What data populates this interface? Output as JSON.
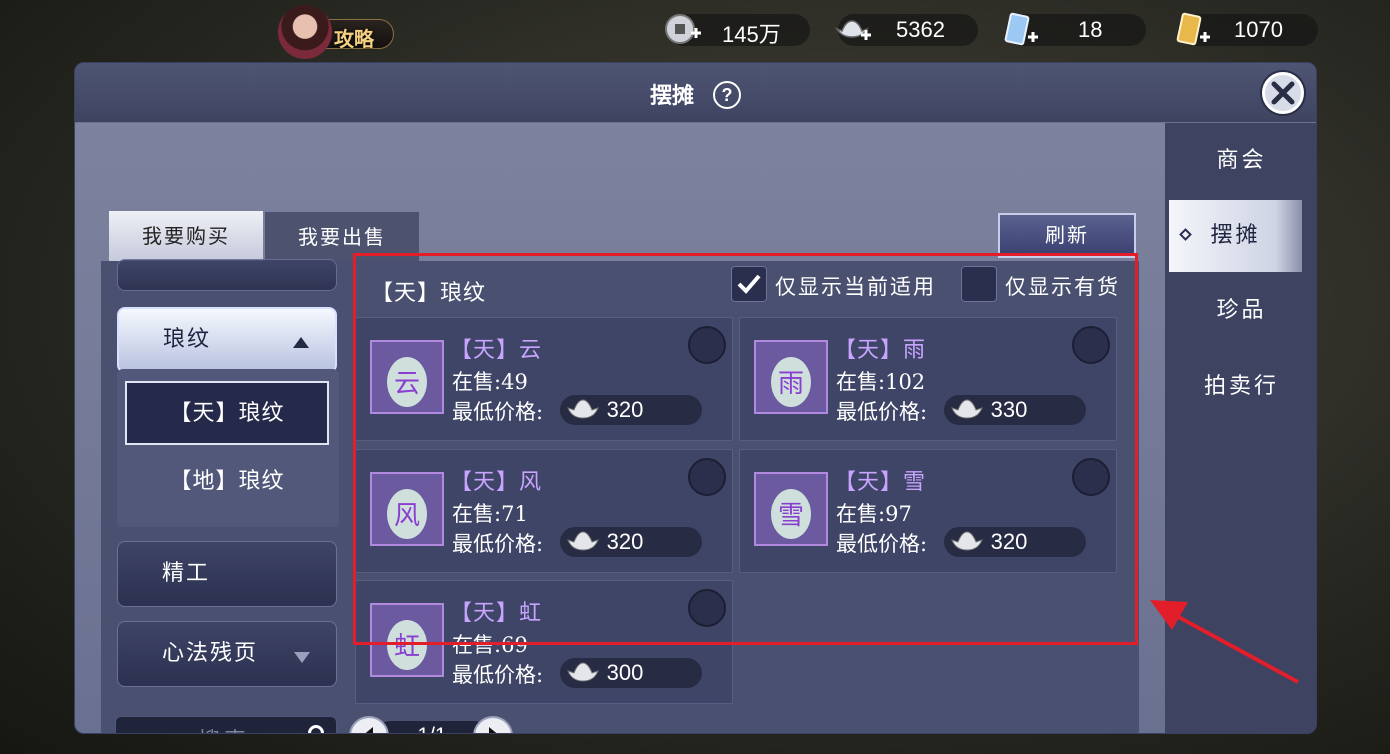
{
  "topbar": {
    "guide_label": "攻略",
    "currencies": [
      {
        "icon": "coin-icon",
        "value": "145万"
      },
      {
        "icon": "silver-ingot-icon",
        "value": "5362"
      },
      {
        "icon": "blue-ticket-icon",
        "value": "18"
      },
      {
        "icon": "gold-ticket-icon",
        "value": "1070"
      }
    ]
  },
  "panel": {
    "title": "摆摊",
    "help": "?"
  },
  "tabs": {
    "buy": "我要购买",
    "sell": "我要出售",
    "refresh": "刷新"
  },
  "sidebar": {
    "items": [
      "商会",
      "摆摊",
      "珍品",
      "拍卖行"
    ],
    "active": "摆摊"
  },
  "categories": {
    "open": "琅纹",
    "sub": [
      "【天】琅纹",
      "【地】琅纹"
    ],
    "selected_sub": "【天】琅纹",
    "others": [
      "精工",
      "心法残页"
    ]
  },
  "list": {
    "title": "【天】琅纹",
    "filter_applicable": {
      "label": "仅显示当前适用",
      "checked": true
    },
    "filter_in_stock": {
      "label": "仅显示有货",
      "checked": false
    },
    "count_prefix": "在售:",
    "price_label": "最低价格:",
    "items": [
      {
        "name": "【天】云",
        "count": "49",
        "price": "320",
        "glyph": "云"
      },
      {
        "name": "【天】雨",
        "count": "102",
        "price": "330",
        "glyph": "雨"
      },
      {
        "name": "【天】风",
        "count": "71",
        "price": "320",
        "glyph": "风"
      },
      {
        "name": "【天】雪",
        "count": "97",
        "price": "320",
        "glyph": "雪"
      },
      {
        "name": "【天】虹",
        "count": "69",
        "price": "300",
        "glyph": "虹"
      }
    ]
  },
  "search": {
    "placeholder": "搜索"
  },
  "pagination": {
    "text": "1/1"
  },
  "colors": {
    "highlight_box": "#e21e2a",
    "item_name": "#c8a4ff",
    "panel": "#5b6280"
  }
}
